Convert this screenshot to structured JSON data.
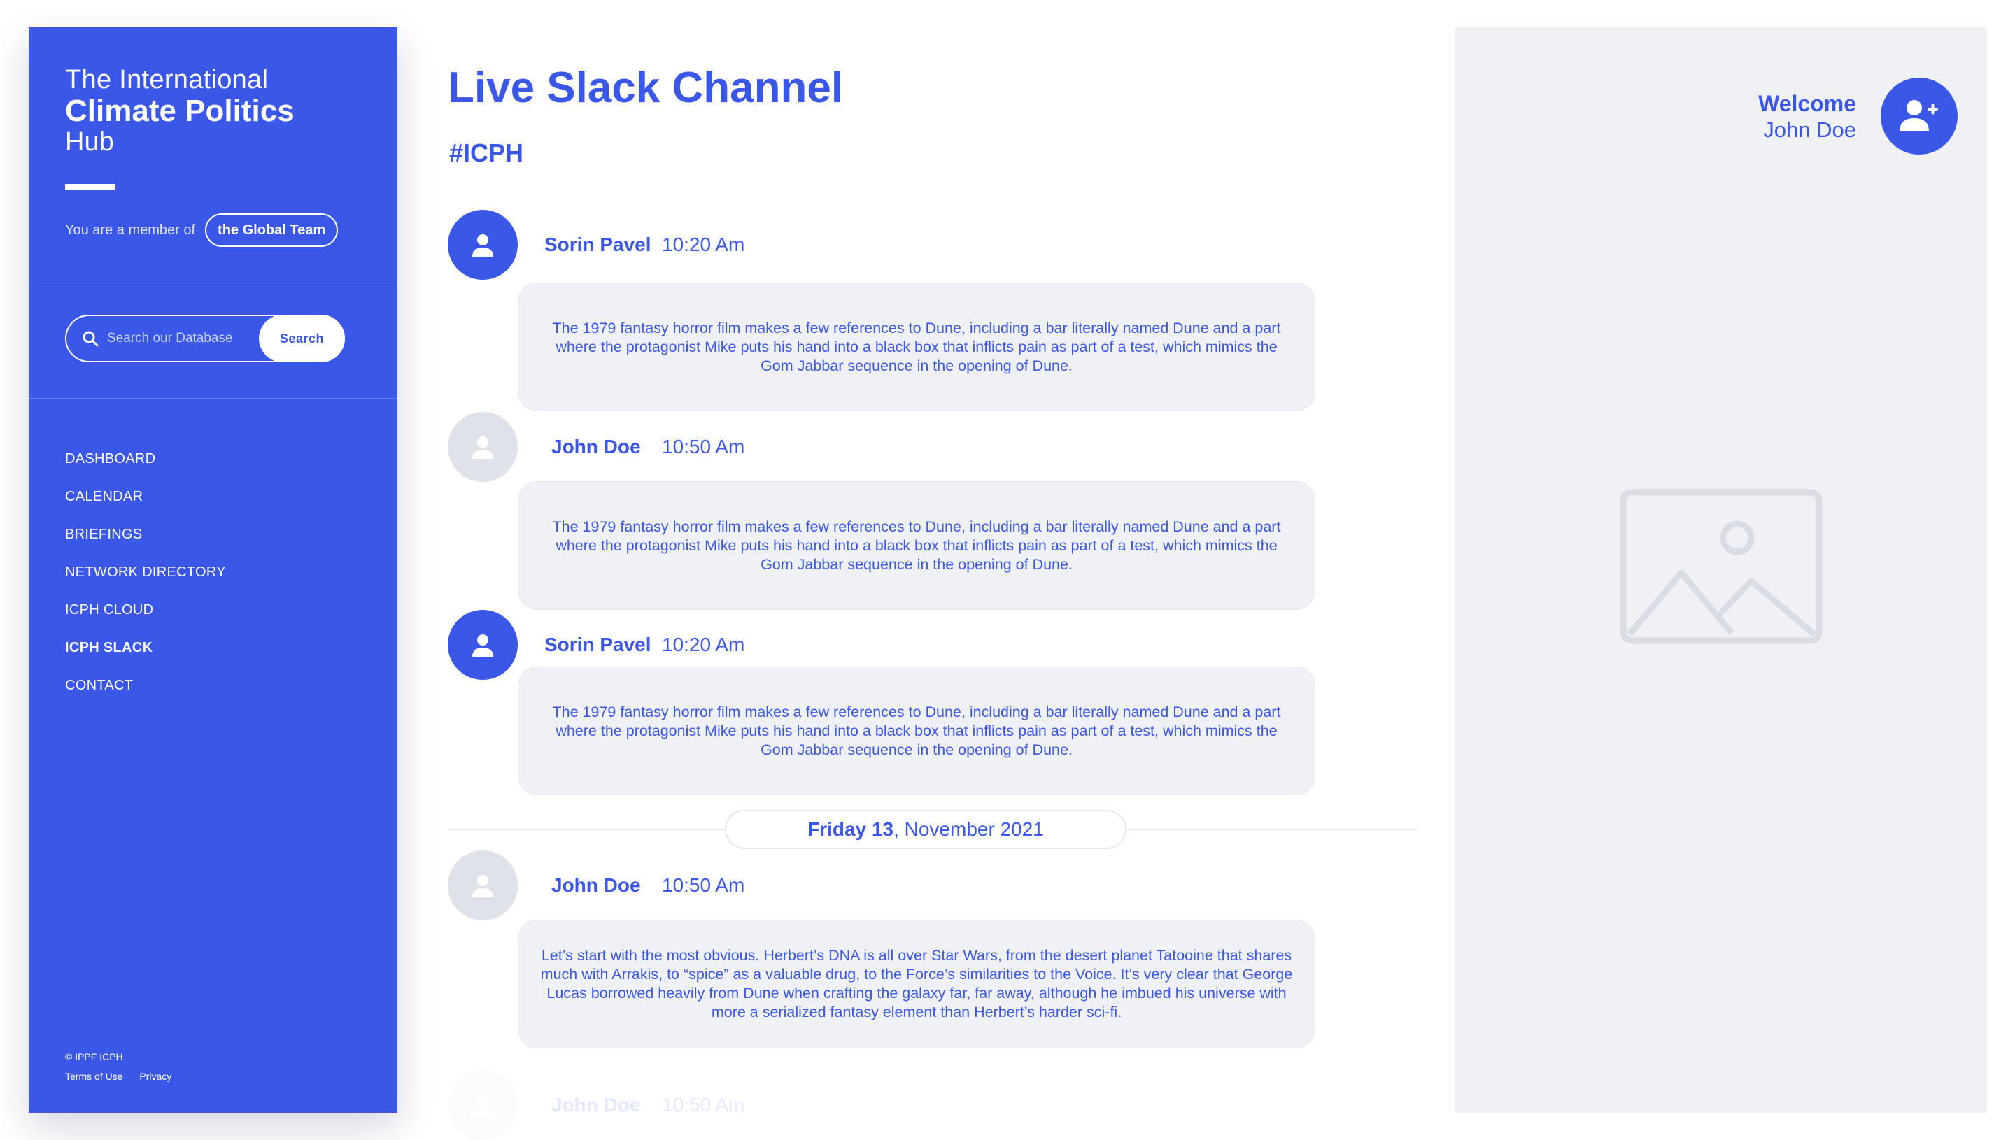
{
  "sidebar": {
    "brand": {
      "line1": "The International",
      "line2": "Climate Politics",
      "line3": "Hub"
    },
    "member_text": "You are a member of",
    "team": "the Global Team",
    "search": {
      "placeholder": "Search our Database",
      "button": "Search"
    },
    "nav": [
      {
        "label": "DASHBOARD",
        "active": false
      },
      {
        "label": "CALENDAR",
        "active": false
      },
      {
        "label": "BRIEFINGS",
        "active": false
      },
      {
        "label": "NETWORK DIRECTORY",
        "active": false
      },
      {
        "label": "ICPH CLOUD",
        "active": false
      },
      {
        "label": "ICPH SLACK",
        "active": true
      },
      {
        "label": "CONTACT",
        "active": false
      }
    ],
    "footer": {
      "copyright": "© IPPF ICPH",
      "terms": "Terms of Use",
      "privacy": "Privacy"
    }
  },
  "main": {
    "title": "Live Slack Channel",
    "channel": "#ICPH",
    "messages": [
      {
        "author": "Sorin Pavel",
        "time": "10:20 Am",
        "avatar": "user-icon-blue",
        "text": "The 1979 fantasy horror film makes a few references to Dune, including a bar literally named Dune and a part where the protagonist Mike puts his hand into a black box that inflicts pain as part of a test, which mimics the Gom Jabbar sequence in the opening of Dune."
      },
      {
        "author": "John Doe",
        "time": "10:50 Am",
        "avatar": "user-icon-grey",
        "text": "The 1979 fantasy horror film makes a few references to Dune, including a bar literally named Dune and a part where the protagonist Mike puts his hand into a black box that inflicts pain as part of a test, which mimics the Gom Jabbar sequence in the opening of Dune."
      },
      {
        "author": "Sorin Pavel",
        "time": "10:20 Am",
        "avatar": "user-icon-blue",
        "text": "The 1979 fantasy horror film makes a few references to Dune, including a bar literally named Dune and a part where the protagonist Mike puts his hand into a black box that inflicts pain as part of a test, which mimics the Gom Jabbar sequence in the opening of Dune."
      },
      {
        "author": "John Doe",
        "time": "10:50 Am",
        "avatar": "user-icon-grey",
        "text": "Let’s start with the most obvious. Herbert’s DNA is all over Star Wars, from the desert planet Tatooine that shares much with Arrakis, to “spice” as a valuable drug, to the Force’s similarities to the Voice. It’s very clear that George Lucas borrowed heavily from Dune when crafting the galaxy far, far away, although he imbued his universe with more a serialized fantasy element than Herbert’s harder sci-fi."
      },
      {
        "author": "John Doe",
        "time": "10:50 Am",
        "avatar": "user-icon-grey"
      }
    ],
    "date_divider": {
      "day": "Friday 13",
      "rest": ", November 2021"
    }
  },
  "right_panel": {
    "welcome_label": "Welcome",
    "user_name": "John Doe",
    "avatar_icon": "add-user-icon",
    "placeholder_icon": "image-placeholder-icon"
  },
  "colors": {
    "accent": "#3a57e8",
    "bubble": "#eff1f6",
    "panel": "#f0f1f5",
    "avatar_grey": "#dfe2e8"
  }
}
